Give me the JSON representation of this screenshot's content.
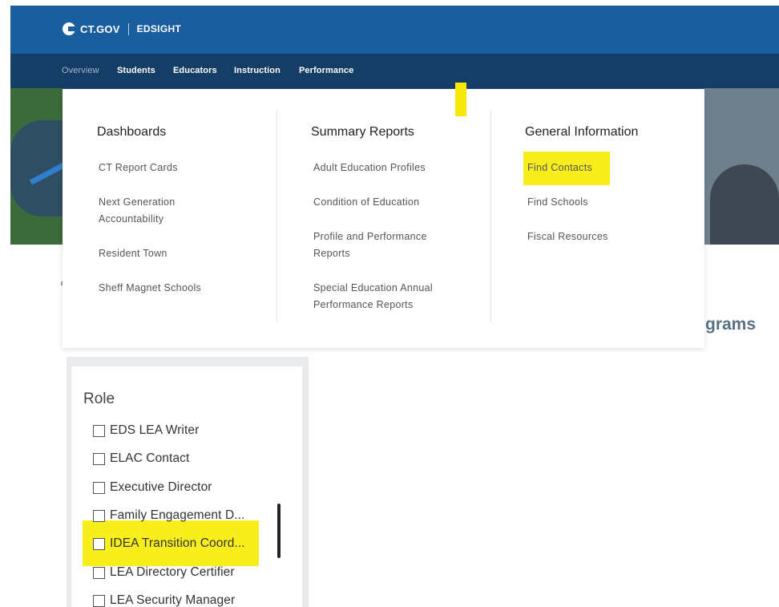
{
  "header": {
    "logo_text": "CT.GOV",
    "site_name": "EDSIGHT",
    "brand_color": "#1b5ea0",
    "nav_color": "#143e66",
    "highlight_color": "#f7ee1c"
  },
  "nav": {
    "items": [
      {
        "label": "Overview",
        "active": true
      },
      {
        "label": "Students"
      },
      {
        "label": "Educators"
      },
      {
        "label": "Instruction"
      },
      {
        "label": "Performance"
      }
    ]
  },
  "menu": {
    "dashboards": {
      "title": "Dashboards",
      "links": [
        "CT Report Cards",
        "Next Generation Accountability",
        "Resident Town",
        "Sheff Magnet Schools"
      ]
    },
    "summary": {
      "title": "Summary Reports",
      "links": [
        "Adult Education Profiles",
        "Condition of Education",
        "Profile and Performance Reports",
        "Special Education Annual Performance Reports"
      ]
    },
    "general": {
      "title": "General Information",
      "links": [
        "Find Contacts",
        "Find Schools",
        "Fiscal Resources"
      ]
    }
  },
  "page": {
    "heading_fragment": "grams"
  },
  "role_filter": {
    "title": "Role",
    "options": [
      "EDS LEA Writer",
      "ELAC Contact",
      "Executive Director",
      "Family Engagement D...",
      "IDEA Transition Coord...",
      "LEA Directory Certifier",
      "LEA Security Manager"
    ]
  }
}
